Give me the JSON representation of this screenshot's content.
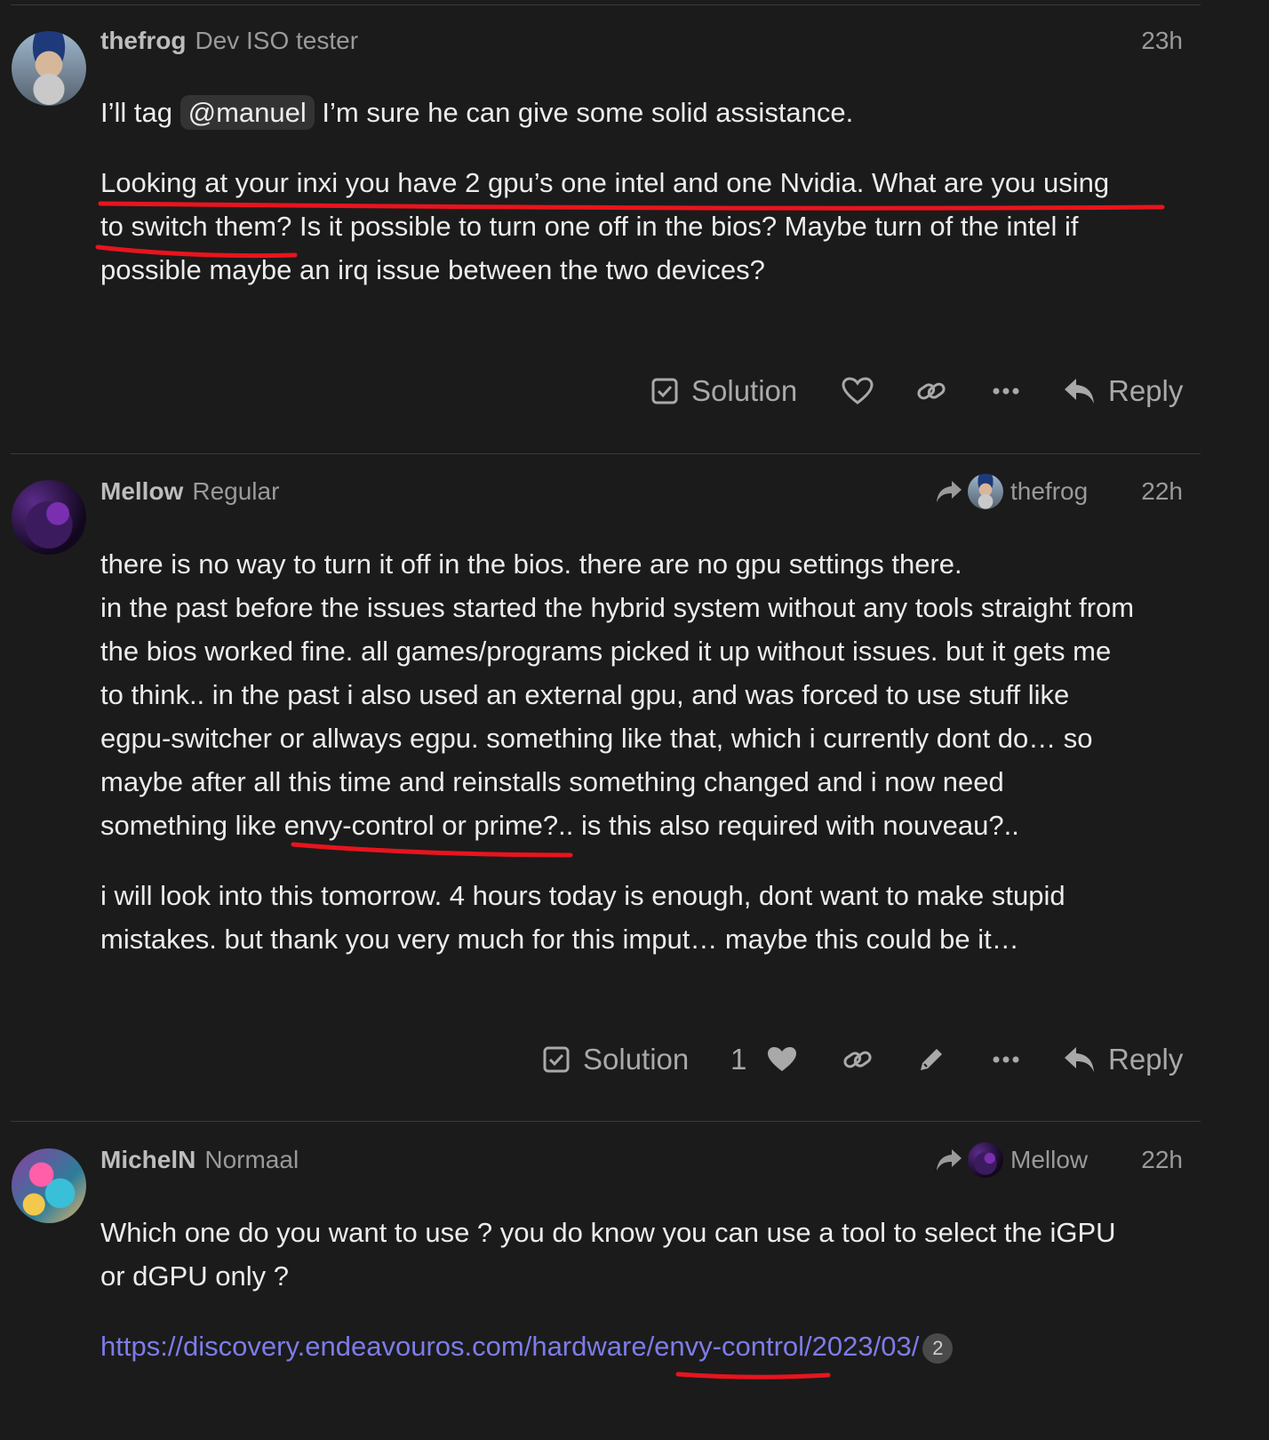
{
  "posts": [
    {
      "username": "thefrog",
      "title": "Dev ISO tester",
      "time": "23h",
      "p1_before": "I’ll tag ",
      "p1_mention": "@manuel",
      "p1_after": " I’m sure he can give some solid assistance.",
      "p2_lines": [
        "Looking at your inxi you have 2 gpu’s one intel and one Nvidia. What are you using",
        "to switch them? Is it possible to turn one off in the bios? Maybe turn of the intel if",
        "possible maybe an irq issue between the two devices?"
      ],
      "actions": {
        "solution": "Solution",
        "reply": "Reply"
      }
    },
    {
      "username": "Mellow",
      "title": "Regular",
      "time": "22h",
      "reply_to": "thefrog",
      "p1_lines": [
        "there is no way to turn it off in the bios. there are no gpu settings there.",
        "in the past before the issues started the hybrid system without any tools straight from",
        "the bios worked fine. all games/programs picked it up without issues. but it gets me",
        "to think.. in the past i also used an external gpu, and was forced to use stuff like",
        "egpu-switcher or allways egpu. something like that, which i currently dont do… so",
        "maybe after all this time and reinstalls something changed and i now need",
        "something like envy-control or prime?.. is this also required with nouveau?.."
      ],
      "p2_lines": [
        "i will look into this tomorrow. 4 hours today is enough, dont want to make stupid",
        "mistakes. but thank you very much for this imput… maybe this could be it…"
      ],
      "actions": {
        "solution": "Solution",
        "like_count": "1",
        "reply": "Reply"
      }
    },
    {
      "username": "MichelN",
      "title": "Normaal",
      "time": "22h",
      "reply_to": "Mellow",
      "p1_lines": [
        "Which one do you want to use ? you do know you can use a tool to select the iGPU",
        "or dGPU only ?"
      ],
      "link": "https://discovery.endeavouros.com/hardware/envy-control/2023/03/",
      "link_clicks": "2"
    }
  ],
  "colors": {
    "background": "#1b1b1b",
    "text": "#ececec",
    "muted": "#9a9a9a",
    "link": "#7d7ce8",
    "annotation": "#e8141e"
  },
  "icons": [
    "check-square-icon",
    "heart-outline-icon",
    "heart-filled-icon",
    "link-icon",
    "ellipsis-icon",
    "pencil-icon",
    "reply-icon",
    "share-arrow-icon"
  ]
}
